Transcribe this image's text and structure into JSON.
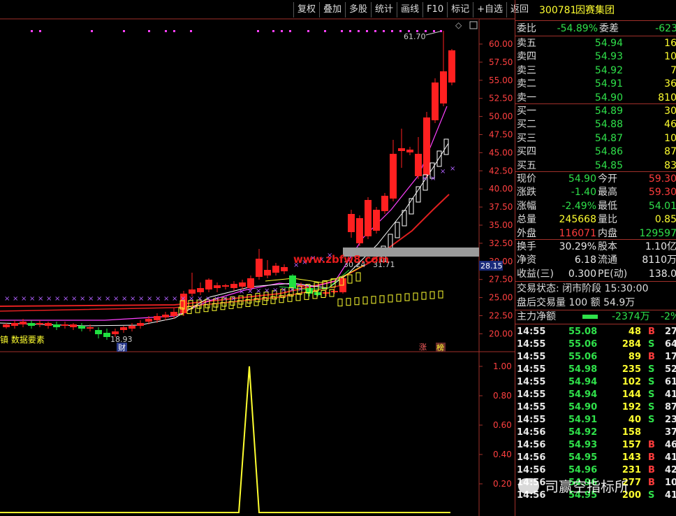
{
  "toolbar": {
    "buttons": [
      "复权",
      "叠加",
      "多股",
      "统计",
      "画线",
      "F10",
      "标记",
      "+自选",
      "返回"
    ]
  },
  "stock": {
    "code": "300781",
    "name": "因赛集团"
  },
  "chart": {
    "y_ticks": [
      "60.00",
      "57.50",
      "55.00",
      "52.50",
      "50.00",
      "47.50",
      "45.00",
      "42.50",
      "40.00",
      "37.50",
      "35.00",
      "32.50",
      "30.00",
      "27.50",
      "25.00",
      "22.50",
      "20.00"
    ],
    "current_price_tag": "28.15",
    "high_label": "61.70",
    "low_label": "18.93",
    "mid_label_1": "30.24",
    "mid_label_2": "31.71",
    "watermark": "www.zbfw8.com",
    "indicator_label": "镇 数据要素",
    "marker_cai": "财",
    "marker_zhang": "涨",
    "marker_bang": "榜",
    "ind_ticks": [
      "1.00",
      "0.80",
      "0.60",
      "0.40",
      "0.20"
    ]
  },
  "quote": {
    "weibi_label": "委比",
    "weibi_value": "-54.89%",
    "weicha_label": "委差",
    "weicha_value": "-623",
    "asks": [
      {
        "label": "卖五",
        "price": "54.94",
        "vol": "16"
      },
      {
        "label": "卖四",
        "price": "54.93",
        "vol": "10"
      },
      {
        "label": "卖三",
        "price": "54.92",
        "vol": "7"
      },
      {
        "label": "卖二",
        "price": "54.91",
        "vol": "36"
      },
      {
        "label": "卖一",
        "price": "54.90",
        "vol": "810"
      }
    ],
    "bids": [
      {
        "label": "买一",
        "price": "54.89",
        "vol": "30"
      },
      {
        "label": "买二",
        "price": "54.88",
        "vol": "46"
      },
      {
        "label": "买三",
        "price": "54.87",
        "vol": "10"
      },
      {
        "label": "买四",
        "price": "54.86",
        "vol": "87"
      },
      {
        "label": "买五",
        "price": "54.85",
        "vol": "83"
      }
    ],
    "stats": [
      {
        "l1": "现价",
        "v1": "54.90",
        "l2": "今开",
        "v2": "59.30"
      },
      {
        "l1": "涨跌",
        "v1": "-1.40",
        "l2": "最高",
        "v2": "59.30"
      },
      {
        "l1": "涨幅",
        "v1": "-2.49%",
        "l2": "最低",
        "v2": "54.01"
      },
      {
        "l1": "总量",
        "v1": "245668",
        "l2": "量比",
        "v2": "0.85"
      },
      {
        "l1": "外盘",
        "v1": "116071",
        "l2": "内盘",
        "v2": "129597"
      }
    ],
    "stats2": [
      {
        "l1": "换手",
        "v1": "30.29%",
        "l2": "股本",
        "v2": "1.10亿"
      },
      {
        "l1": "净资",
        "v1": "6.18",
        "l2": "流通",
        "v2": "8110万"
      },
      {
        "l1": "收益(三)",
        "v1": "0.300",
        "l2": "PE(动)",
        "v2": "138.0"
      }
    ],
    "trade_status": "交易状态: 闭市阶段 15:30:00",
    "after_hours": "盘后交易量 100 额 54.9万",
    "main_net_label": "主力净额",
    "main_net_value": "-2374万",
    "main_net_pct": "-2%"
  },
  "ticks": [
    {
      "t": "14:55",
      "p": "55.08",
      "v": "48",
      "d": "B",
      "x": "27"
    },
    {
      "t": "14:55",
      "p": "55.06",
      "v": "284",
      "d": "S",
      "x": "64"
    },
    {
      "t": "14:55",
      "p": "55.06",
      "v": "89",
      "d": "B",
      "x": "17"
    },
    {
      "t": "14:55",
      "p": "54.98",
      "v": "235",
      "d": "S",
      "x": "52"
    },
    {
      "t": "14:55",
      "p": "54.94",
      "v": "102",
      "d": "S",
      "x": "61"
    },
    {
      "t": "14:55",
      "p": "54.94",
      "v": "144",
      "d": "S",
      "x": "41"
    },
    {
      "t": "14:55",
      "p": "54.90",
      "v": "192",
      "d": "S",
      "x": "87"
    },
    {
      "t": "14:55",
      "p": "54.91",
      "v": "40",
      "d": "S",
      "x": "23"
    },
    {
      "t": "14:56",
      "p": "54.92",
      "v": "158",
      "d": "",
      "x": "37"
    },
    {
      "t": "14:56",
      "p": "54.93",
      "v": "157",
      "d": "B",
      "x": "46"
    },
    {
      "t": "14:56",
      "p": "54.95",
      "v": "143",
      "d": "B",
      "x": "41"
    },
    {
      "t": "14:56",
      "p": "54.96",
      "v": "231",
      "d": "B",
      "x": "42"
    },
    {
      "t": "14:56",
      "p": "54.96",
      "v": "277",
      "d": "B",
      "x": "10"
    },
    {
      "t": "14:56",
      "p": "54.95",
      "v": "200",
      "d": "S",
      "x": "41"
    }
  ],
  "wechat_watermark": "司赢空指标所",
  "colors": {
    "up": "#ff2020",
    "down": "#20e040",
    "bg": "#000000",
    "axis": "#a0302a"
  }
}
